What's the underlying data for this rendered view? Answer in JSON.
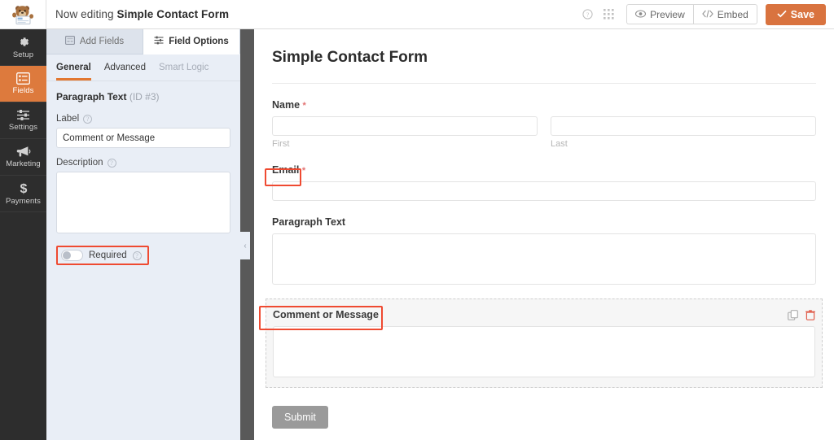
{
  "topbar": {
    "logo_icon": "wpforms-mascot-icon",
    "editing_prefix": "Now editing ",
    "form_name": "Simple Contact Form",
    "help_icon": "help-circle-icon",
    "apps_icon": "grid-apps-icon",
    "preview_label": "Preview",
    "preview_icon": "eye-icon",
    "embed_label": "Embed",
    "embed_icon": "code-icon",
    "save_label": "Save",
    "save_icon": "check-icon",
    "save_color": "#d9733f"
  },
  "sidebar": {
    "items": [
      {
        "label": "Setup",
        "icon": "gear-icon",
        "active": false
      },
      {
        "label": "Fields",
        "icon": "list-form-icon",
        "active": true
      },
      {
        "label": "Settings",
        "icon": "sliders-icon",
        "active": false
      },
      {
        "label": "Marketing",
        "icon": "megaphone-icon",
        "active": false
      },
      {
        "label": "Payments",
        "icon": "dollar-icon",
        "active": false
      }
    ],
    "active_color": "#dd7a3d",
    "background_color": "#2d2d2d"
  },
  "panel": {
    "tabs": [
      {
        "label": "Add Fields",
        "icon": "fields-grid-icon",
        "active": false
      },
      {
        "label": "Field Options",
        "icon": "options-sliders-icon",
        "active": true
      }
    ],
    "subtabs": [
      {
        "label": "General",
        "active": true,
        "muted": false
      },
      {
        "label": "Advanced",
        "active": false,
        "muted": false
      },
      {
        "label": "Smart Logic",
        "active": false,
        "muted": true
      }
    ],
    "field_type": "Paragraph Text",
    "field_id": " (ID #3)",
    "label_title": "Label",
    "label_value": "Comment or Message",
    "description_title": "Description",
    "description_value": "",
    "required_label": "Required",
    "required_on": false,
    "help_glyph": "?",
    "collapse_icon": "chevron-left-icon"
  },
  "preview": {
    "form_title": "Simple Contact Form",
    "fields": [
      {
        "label": "Name",
        "required": true,
        "type": "name-two-part",
        "sublabels": [
          "First",
          "Last"
        ],
        "selected": false,
        "annotated": false
      },
      {
        "label": "Email",
        "required": true,
        "type": "text",
        "selected": false,
        "annotated": true
      },
      {
        "label": "Paragraph Text",
        "required": false,
        "type": "textarea",
        "selected": false,
        "annotated": false
      },
      {
        "label": "Comment or Message",
        "required": false,
        "type": "textarea",
        "selected": true,
        "annotated": true,
        "duplicate_icon": "duplicate-icon",
        "delete_icon": "trash-icon"
      }
    ],
    "submit_label": "Submit",
    "required_marker": "*",
    "annotation_color": "#ef4a31"
  }
}
